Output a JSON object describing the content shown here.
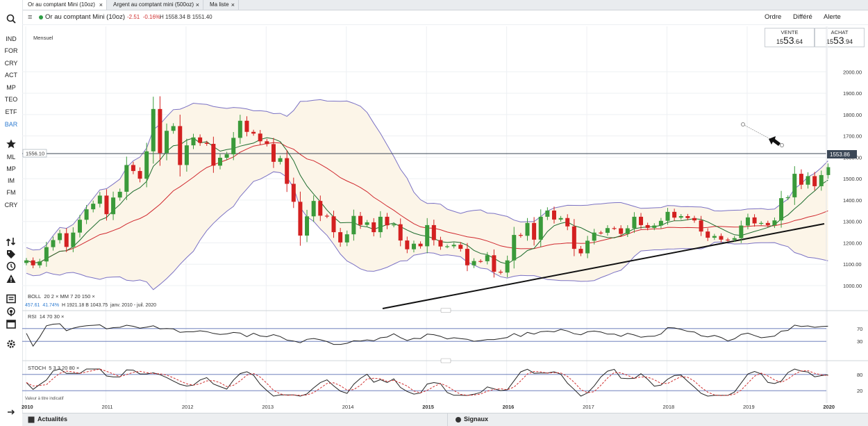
{
  "tabs": [
    {
      "label": "Or au comptant Mini (10oz)",
      "active": true
    },
    {
      "label": "Argent au comptant mini (500oz)",
      "active": false
    },
    {
      "label": "Ma liste",
      "active": false
    }
  ],
  "sidebar": {
    "categories": [
      "IND",
      "FOR",
      "CRY",
      "ACT",
      "MP",
      "TEO",
      "ETF",
      "BAR"
    ],
    "active_category": "BAR",
    "favorites": [
      "ML",
      "MP",
      "IM",
      "FM",
      "CRY"
    ],
    "icons": [
      "search-icon",
      "star-icon",
      "exchange-icon",
      "tag-icon",
      "clock-icon",
      "alert-icon",
      "news-icon",
      "broadcast-icon",
      "calendar-icon",
      "settings-icon",
      "expand-arrow-icon"
    ]
  },
  "header": {
    "instrument": "Or au comptant Mini (10oz)",
    "change": "-2.51",
    "change_pct": "-0.16%",
    "high_low": "H 1558.34 B 1551.40",
    "buttons": [
      "Ordre",
      "Différé",
      "Alerte"
    ]
  },
  "quotes": {
    "sell": {
      "label": "VENTE",
      "prefix": "15",
      "big": "53",
      "suffix": ".64"
    },
    "buy": {
      "label": "ACHAT",
      "prefix": "15",
      "big": "53",
      "suffix": ".94"
    }
  },
  "chart": {
    "period_label": "Mensuel",
    "hline_label": "1556.10",
    "last_price_label": "1553.86",
    "indicator_label": "BOLL",
    "indicator_params": "20  2  ×  MM  7  20  150  ×",
    "stats_line": {
      "a": "457.61",
      "b": "41.74%",
      "c": "H 1921.18  B 1043.75",
      "d": "janv. 2010 - juil. 2020"
    },
    "footnote": "Valeur à titre indicatif"
  },
  "rsi": {
    "label": "RSI",
    "params": "14  70  30  ×",
    "levels": [
      "70",
      "30"
    ]
  },
  "stoch": {
    "label": "STOCH",
    "params": "5  3  3  20  80  ×",
    "levels": [
      "80",
      "20"
    ]
  },
  "bottom": {
    "left": "Actualités",
    "right": "Signaux"
  },
  "chart_data": {
    "type": "candlestick",
    "period": "monthly",
    "y_ticks": [
      "1000.00",
      "1100.00",
      "1200.00",
      "1300.00",
      "1400.00",
      "1500.00",
      "1600.00",
      "1700.00",
      "1800.00",
      "1900.00",
      "2000.00"
    ],
    "ylim": [
      960,
      2030
    ],
    "x_ticks": [
      "2010",
      "2011",
      "2012",
      "2013",
      "2014",
      "2015",
      "2016",
      "2017",
      "2018",
      "2019",
      "2020"
    ],
    "candles_close": [
      1118,
      1095,
      1113,
      1180,
      1213,
      1245,
      1181,
      1248,
      1308,
      1357,
      1383,
      1421,
      1334,
      1412,
      1439,
      1564,
      1536,
      1500,
      1628,
      1826,
      1620,
      1724,
      1746,
      1564,
      1656,
      1693,
      1668,
      1663,
      1561,
      1598,
      1614,
      1691,
      1771,
      1719,
      1711,
      1675,
      1662,
      1579,
      1596,
      1476,
      1392,
      1234,
      1324,
      1396,
      1327,
      1324,
      1250,
      1202,
      1240,
      1326,
      1284,
      1296,
      1250,
      1322,
      1282,
      1287,
      1211,
      1170,
      1196,
      1184,
      1283,
      1213,
      1183,
      1184,
      1191,
      1172,
      1095,
      1115,
      1114,
      1142,
      1065,
      1061,
      1118,
      1237,
      1233,
      1293,
      1215,
      1322,
      1351,
      1309,
      1316,
      1277,
      1172,
      1151,
      1210,
      1248,
      1247,
      1269,
      1268,
      1242,
      1268,
      1322,
      1283,
      1270,
      1281,
      1303,
      1345,
      1318,
      1325,
      1316,
      1305,
      1253,
      1224,
      1232,
      1215,
      1214,
      1222,
      1281,
      1319,
      1291,
      1293,
      1283,
      1305,
      1409,
      1413,
      1523,
      1472,
      1512,
      1465,
      1517,
      1554
    ]
  }
}
